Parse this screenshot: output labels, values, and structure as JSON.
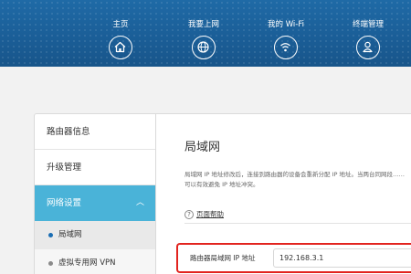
{
  "nav": [
    {
      "label": "主页",
      "icon": "home-icon"
    },
    {
      "label": "我要上网",
      "icon": "globe-icon"
    },
    {
      "label": "我的 Wi-Fi",
      "icon": "wifi-icon"
    },
    {
      "label": "终端管理",
      "icon": "user-icon"
    }
  ],
  "sidebar": {
    "items": [
      {
        "label": "路由器信息"
      },
      {
        "label": "升级管理"
      },
      {
        "label": "网络设置",
        "chevron": "︿"
      }
    ],
    "sub_items": [
      {
        "label": "局域网"
      },
      {
        "label": "虚拟专用网 VPN"
      }
    ]
  },
  "main": {
    "title": "局域网",
    "description": "局域网 IP 地址修改后，连接到路由器的设备会重新分配 IP 地址。当两台同网段……可以有效避免 IP 地址冲突。",
    "help_icon": "?",
    "help_label": "页面帮助",
    "field": {
      "label": "路由器局域网 IP 地址",
      "value": "192.168.3.1"
    }
  },
  "colors": {
    "topbar": "#1a5d96",
    "active": "#4ab3d8",
    "highlight_border": "#e2241f"
  }
}
